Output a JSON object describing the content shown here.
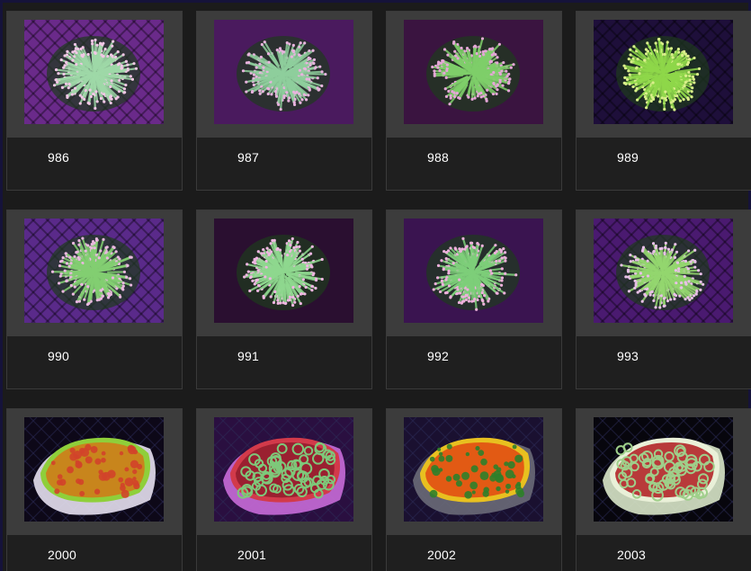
{
  "gallery": {
    "items": [
      {
        "id": "986",
        "kind": "torch",
        "bg": "#6a2a8a",
        "polyp": "#9fd9a8",
        "tip": "#f2c7e6",
        "mesh": true
      },
      {
        "id": "987",
        "kind": "torch",
        "bg": "#4a1a5e",
        "polyp": "#8fcf9d",
        "tip": "#e8b3de",
        "mesh": false
      },
      {
        "id": "988",
        "kind": "torch",
        "bg": "#3a1440",
        "polyp": "#7fcf6a",
        "tip": "#e6a6d8",
        "mesh": false
      },
      {
        "id": "989",
        "kind": "torch",
        "bg": "#1e0f3a",
        "polyp": "#8fd84a",
        "tip": "#d9ef8a",
        "mesh": true
      },
      {
        "id": "990",
        "kind": "torch",
        "bg": "#5a2a8a",
        "polyp": "#83cf72",
        "tip": "#eab8e0",
        "mesh": true
      },
      {
        "id": "991",
        "kind": "torch",
        "bg": "#2a0f30",
        "polyp": "#8fd88f",
        "tip": "#f0b6e2",
        "mesh": false
      },
      {
        "id": "992",
        "kind": "torch",
        "bg": "#3a1450",
        "polyp": "#7ecf7a",
        "tip": "#eeb0dc",
        "mesh": false
      },
      {
        "id": "993",
        "kind": "torch",
        "bg": "#4a1a70",
        "polyp": "#94d76f",
        "tip": "#e9c0e8",
        "mesh": true
      },
      {
        "id": "2000",
        "kind": "chalice",
        "bg": "#0d0818",
        "base": "#e6e0f0",
        "main": "#c8851c",
        "spot": "#d2432a",
        "rim": "#8fcf3a"
      },
      {
        "id": "2001",
        "kind": "brain",
        "bg": "#2a0f40",
        "base": "#c86bd8",
        "main": "#9a2030",
        "spot": "#7ec87a",
        "rim": "#d23a4a"
      },
      {
        "id": "2002",
        "kind": "chalice",
        "bg": "#1a1030",
        "base": "#6a6a78",
        "main": "#e25a14",
        "spot": "#2f7f2a",
        "rim": "#e8c020"
      },
      {
        "id": "2003",
        "kind": "brain",
        "bg": "#07060d",
        "base": "#d8e6c8",
        "main": "#b83a3a",
        "spot": "#9fcf8a",
        "rim": "#e9f0d8"
      }
    ]
  }
}
